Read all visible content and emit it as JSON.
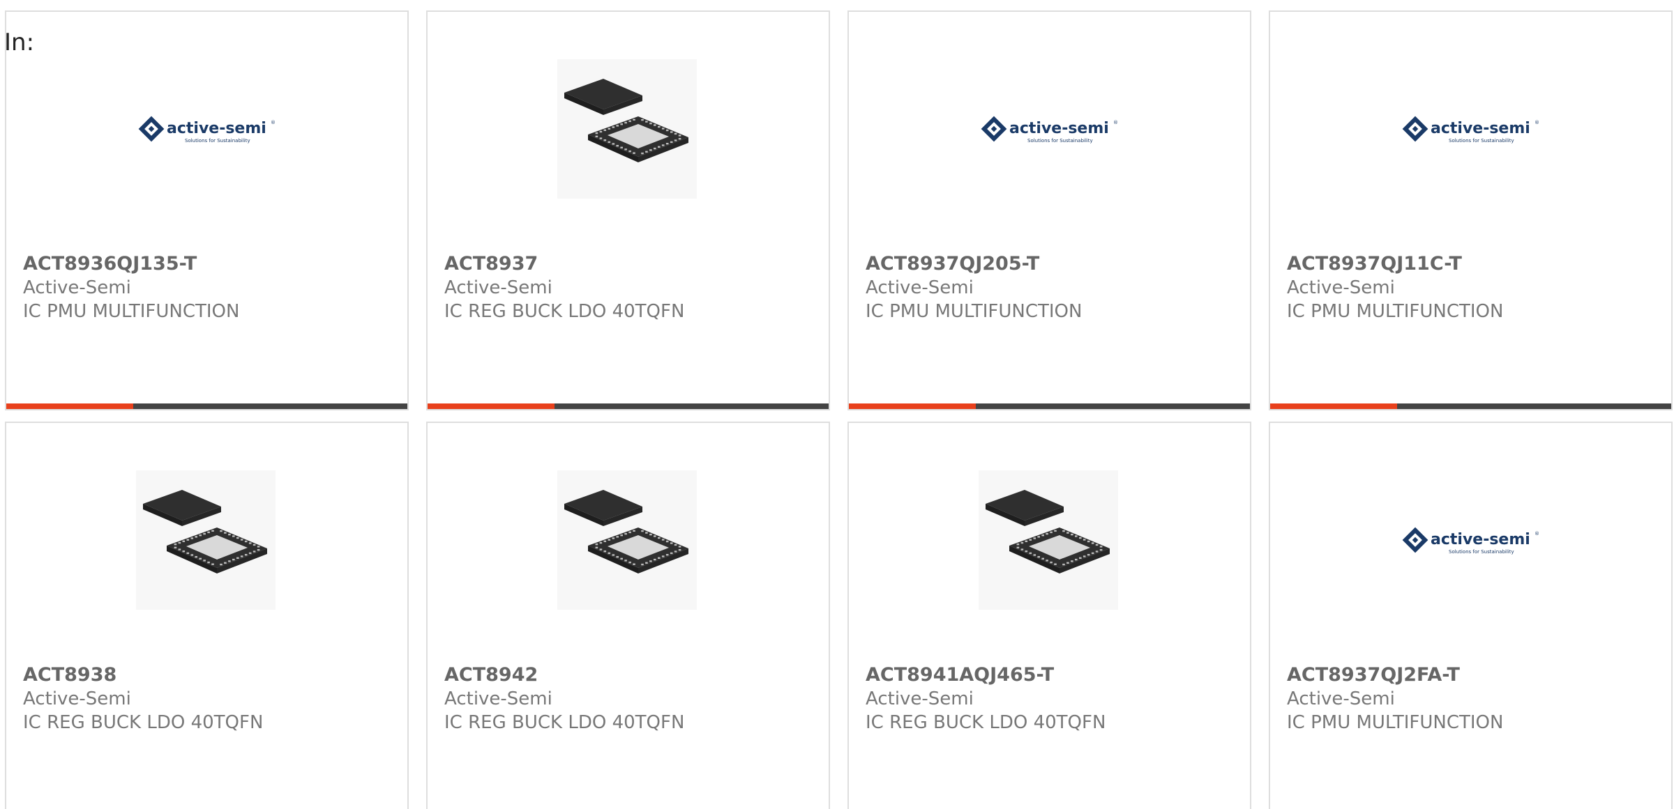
{
  "page": {
    "prefix": "In:"
  },
  "colors": {
    "accent": "#e8401c",
    "bar_dark": "#444444",
    "logo_blue": "#1a3a67"
  },
  "logo": {
    "brand": "active-semi",
    "tagline": "Solutions for Sustainability"
  },
  "products": [
    {
      "part": "ACT8936QJ135-T",
      "manufacturer": "Active-Semi",
      "description": "IC PMU MULTIFUNCTION",
      "image": "logo"
    },
    {
      "part": "ACT8937",
      "manufacturer": "Active-Semi",
      "description": "IC REG BUCK LDO 40TQFN",
      "image": "chip"
    },
    {
      "part": "ACT8937QJ205-T",
      "manufacturer": "Active-Semi",
      "description": "IC PMU MULTIFUNCTION",
      "image": "logo"
    },
    {
      "part": "ACT8937QJ11C-T",
      "manufacturer": "Active-Semi",
      "description": "IC PMU MULTIFUNCTION",
      "image": "logo"
    },
    {
      "part": "ACT8938",
      "manufacturer": "Active-Semi",
      "description": "IC REG BUCK LDO 40TQFN",
      "image": "chip"
    },
    {
      "part": "ACT8942",
      "manufacturer": "Active-Semi",
      "description": "IC REG BUCK LDO 40TQFN",
      "image": "chip"
    },
    {
      "part": "ACT8941AQJ465-T",
      "manufacturer": "Active-Semi",
      "description": "IC REG BUCK LDO 40TQFN",
      "image": "chip"
    },
    {
      "part": "ACT8937QJ2FA-T",
      "manufacturer": "Active-Semi",
      "description": "IC PMU MULTIFUNCTION",
      "image": "logo"
    }
  ]
}
